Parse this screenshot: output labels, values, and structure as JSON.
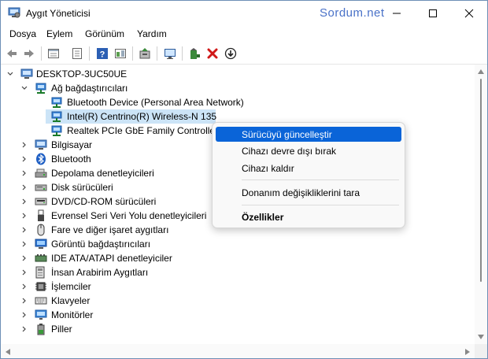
{
  "window": {
    "title": "Aygıt Yöneticisi",
    "watermark": "Sordum.net",
    "controls": [
      "minimize-icon",
      "maximize-icon",
      "close-icon"
    ]
  },
  "menubar": {
    "items": [
      {
        "label": "Dosya"
      },
      {
        "label": "Eylem"
      },
      {
        "label": "Görünüm"
      },
      {
        "label": "Yardım"
      }
    ]
  },
  "toolbar": {
    "buttons": [
      "back-icon",
      "forward-icon",
      "properties-icon",
      "list-icon",
      "help-icon",
      "view-icon",
      "update-driver-icon",
      "monitor-icon",
      "add-driver-icon",
      "uninstall-icon",
      "download-icon"
    ]
  },
  "tree": {
    "root": "DESKTOP-3UC50UE",
    "network": {
      "label": "Ağ bağdaştırıcıları",
      "children": [
        {
          "label": "Bluetooth Device (Personal Area Network)"
        },
        {
          "label": "Intel(R) Centrino(R) Wireless-N 135"
        },
        {
          "label": "Realtek PCIe GbE Family Controller"
        }
      ]
    },
    "categories": [
      {
        "label": "Bilgisayar",
        "icon": "computer-icon"
      },
      {
        "label": "Bluetooth",
        "icon": "bluetooth-icon"
      },
      {
        "label": "Depolama denetleyicileri",
        "icon": "storage-icon"
      },
      {
        "label": "Disk sürücüleri",
        "icon": "disk-icon"
      },
      {
        "label": "DVD/CD-ROM sürücüleri",
        "icon": "dvd-icon"
      },
      {
        "label": "Evrensel Seri Veri Yolu denetleyicileri",
        "icon": "usb-icon"
      },
      {
        "label": "Fare ve diğer işaret aygıtları",
        "icon": "mouse-icon"
      },
      {
        "label": "Görüntü bağdaştırıcıları",
        "icon": "display-icon"
      },
      {
        "label": "IDE ATA/ATAPI denetleyiciler",
        "icon": "ide-icon"
      },
      {
        "label": "İnsan Arabirim Aygıtları",
        "icon": "hid-icon"
      },
      {
        "label": "İşlemciler",
        "icon": "cpu-icon"
      },
      {
        "label": "Klavyeler",
        "icon": "keyboard-icon"
      },
      {
        "label": "Monitörler",
        "icon": "monitor-icon"
      },
      {
        "label": "Piller",
        "icon": "battery-icon"
      }
    ]
  },
  "context_menu": {
    "items": [
      {
        "label": "Sürücüyü güncelleştir",
        "highlighted": true
      },
      {
        "label": "Cihazı devre dışı bırak"
      },
      {
        "label": "Cihazı kaldır"
      },
      {
        "label": "Donanım değişikliklerini tara"
      },
      {
        "label": "Özellikler",
        "bold": true
      }
    ]
  },
  "colors": {
    "accent": "#0a64d8",
    "selection": "#cce4f7",
    "watermark": "#4a72c8"
  }
}
